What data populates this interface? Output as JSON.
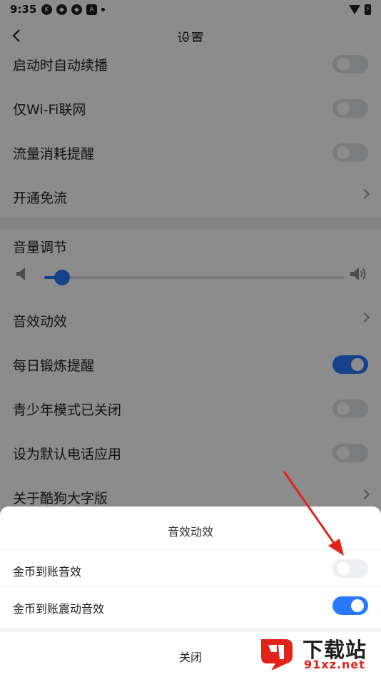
{
  "status_bar": {
    "time": "9:35",
    "icons": [
      "K",
      "◆",
      "◆",
      "A"
    ]
  },
  "header": {
    "title": "设置"
  },
  "settings": {
    "rows": [
      {
        "label": "启动时自动续播",
        "control": "toggle",
        "on": false
      },
      {
        "label": "仅Wi-Fi联网",
        "control": "toggle",
        "on": false
      },
      {
        "label": "流量消耗提醒",
        "control": "toggle",
        "on": false
      },
      {
        "label": "开通免流",
        "control": "chevron"
      }
    ],
    "volume": {
      "label": "音量调节",
      "level": 0.06
    },
    "rows2": [
      {
        "label": "音效动效",
        "control": "chevron"
      },
      {
        "label": "每日锻炼提醒",
        "control": "toggle",
        "on": true
      },
      {
        "label": "青少年模式已关闭",
        "control": "toggle",
        "on": false
      },
      {
        "label": "设为默认电话应用",
        "control": "toggle",
        "on": false
      },
      {
        "label": "关于酷狗大字版",
        "control": "chevron"
      }
    ]
  },
  "sheet": {
    "title": "音效动效",
    "items": [
      {
        "label": "金币到账音效",
        "on": false
      },
      {
        "label": "金币到账震动音效",
        "on": true
      }
    ],
    "close_label": "关闭"
  },
  "watermark": {
    "title": "下载站",
    "url": "91xz.net"
  },
  "colors": {
    "accent": "#2979ff",
    "arrow": "#e2231a"
  }
}
